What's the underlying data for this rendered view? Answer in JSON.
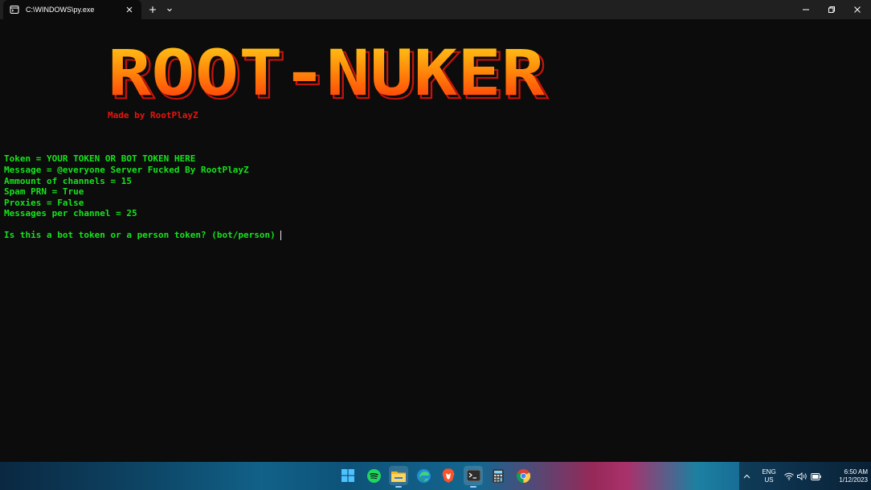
{
  "window": {
    "tab_title": "C:\\WINDOWS\\py.exe",
    "tab_icon": "terminal-icon"
  },
  "banner": {
    "text": "ROOT-NUKER",
    "credit": "Made by RootPlayZ",
    "colors": {
      "top": "#ffd21a",
      "mid": "#ff8a0a",
      "bottom": "#ff2a0a",
      "shadow": "#e0140c"
    }
  },
  "console": {
    "text_color": "#16e31c",
    "lines": [
      "Token = YOUR TOKEN OR BOT TOKEN HERE",
      "Message = @everyone Server Fucked By RootPlayZ",
      "Ammount of channels = 15",
      "Spam PRN = True",
      "Proxies = False",
      "Messages per channel = 25"
    ],
    "prompt": "Is this a bot token or a person token? (bot/person)"
  },
  "taskbar": {
    "apps": [
      "windows-start-icon",
      "spotify-icon",
      "file-explorer-icon",
      "edge-icon",
      "brave-icon",
      "terminal-icon",
      "calculator-icon",
      "chrome-icon"
    ],
    "tray": {
      "lang_top": "ENG",
      "lang_bottom": "US",
      "time": "6:50 AM",
      "date": "1/12/2023"
    }
  }
}
